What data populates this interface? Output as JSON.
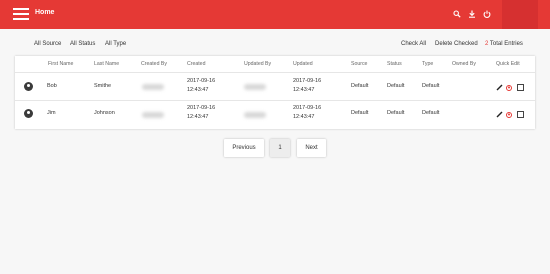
{
  "header": {
    "title": "Home",
    "icons": [
      "search-icon",
      "download-icon",
      "power-icon"
    ],
    "accent": "#e53935"
  },
  "filters": {
    "source": "All Source",
    "status": "All Status",
    "type": "All Type",
    "check_all": "Check All",
    "delete_checked": "Delete Checked",
    "total_count": "2",
    "total_label": "Total Entries"
  },
  "table": {
    "columns": [
      "First Name",
      "Last Name",
      "Created By",
      "Created",
      "Updated By",
      "Updated",
      "Source",
      "Status",
      "Type",
      "Owned By",
      "Quick Edit"
    ],
    "rows": [
      {
        "first_name": "Bob",
        "last_name": "Smithe",
        "created_date": "2017-09-16",
        "created_time": "12:43:47",
        "updated_date": "2017-09-16",
        "updated_time": "12:43:47",
        "source": "Default",
        "status": "Default",
        "type": "Default"
      },
      {
        "first_name": "Jim",
        "last_name": "Johnson",
        "created_date": "2017-09-16",
        "created_time": "12:43:47",
        "updated_date": "2017-09-16",
        "updated_time": "12:43:47",
        "source": "Default",
        "status": "Default",
        "type": "Default"
      }
    ]
  },
  "pagination": {
    "previous": "Previous",
    "current_page": "1",
    "next": "Next"
  }
}
